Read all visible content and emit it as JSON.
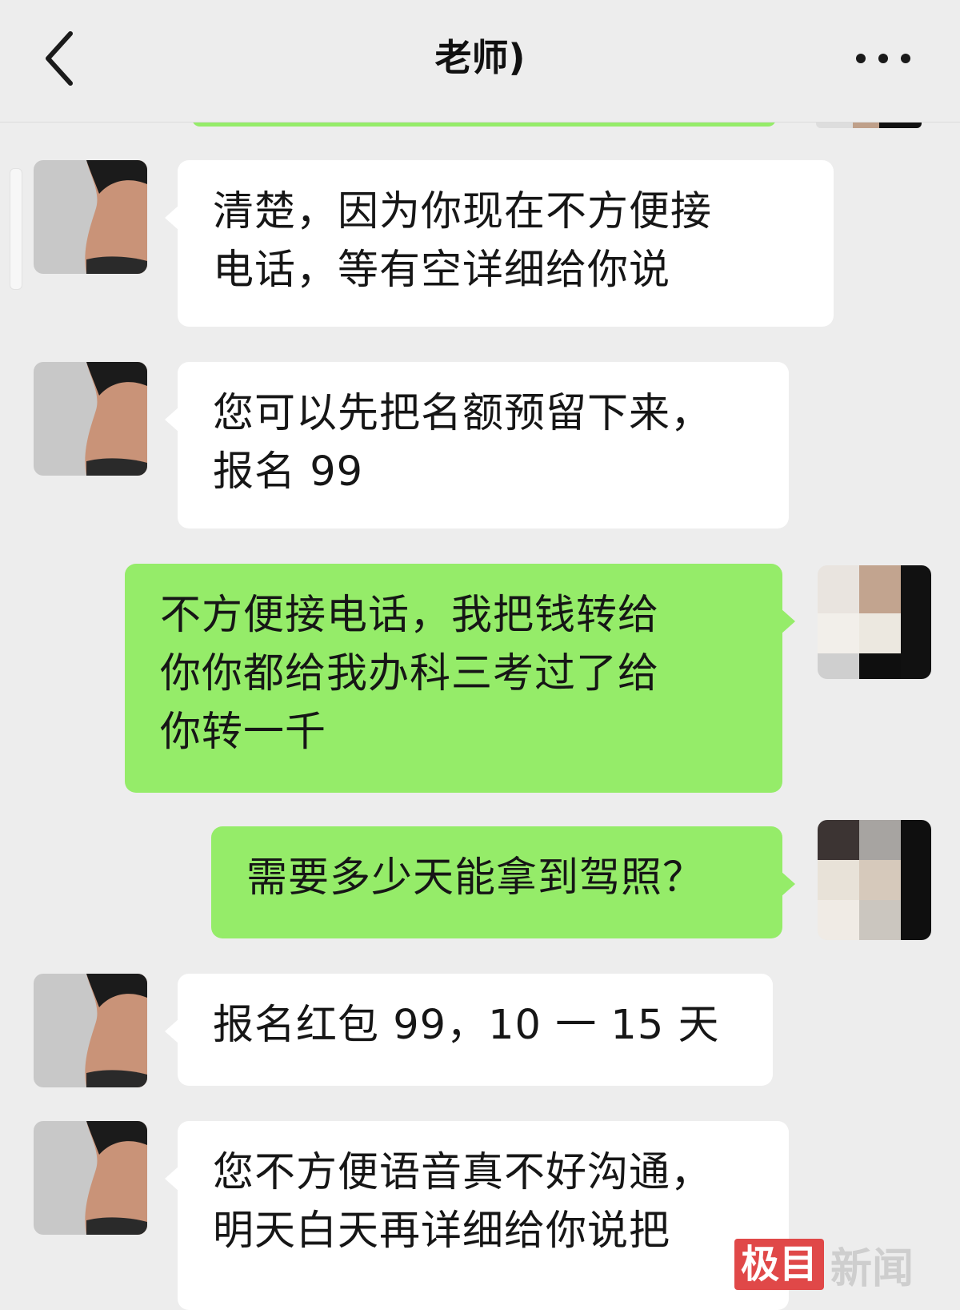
{
  "header": {
    "title": "老师)",
    "back_icon": "chevron-left-icon",
    "more_icon": "more-dots-icon"
  },
  "colors": {
    "background": "#ededed",
    "incoming_bubble": "#ffffff",
    "outgoing_bubble": "#95ec69",
    "watermark_red": "#e04848"
  },
  "messages": [
    {
      "side": "left",
      "lines": [
        "清楚，因为你现在不方便接",
        "电话，等有空详细给你说"
      ]
    },
    {
      "side": "left",
      "lines": [
        "您可以先把名额预留下来，",
        "报名 99"
      ]
    },
    {
      "side": "right",
      "lines": [
        "不方便接电话，我把钱转给",
        "你你都给我办科三考过了给",
        "你转一千"
      ]
    },
    {
      "side": "right",
      "lines": [
        "需要多少天能拿到驾照？"
      ]
    },
    {
      "side": "left",
      "lines": [
        "报名红包 99，10 一 15 天"
      ]
    },
    {
      "side": "left",
      "lines": [
        "您不方便语音真不好沟通，",
        "明天白天再详细给你说把"
      ]
    }
  ],
  "watermark": {
    "box": "极目",
    "text": "新闻"
  }
}
